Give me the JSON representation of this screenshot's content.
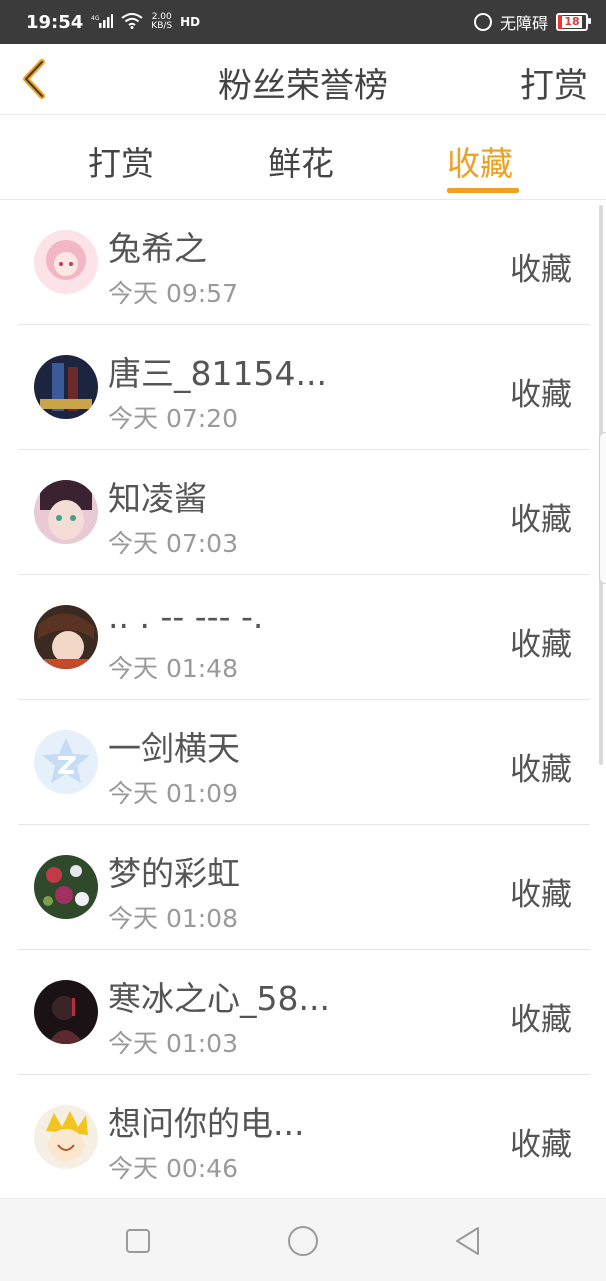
{
  "status_bar": {
    "time": "19:54",
    "network": "4G",
    "speed_value": "2.00",
    "speed_unit": "KB/S",
    "hd": "HD",
    "accessibility": "无障碍",
    "battery": "18"
  },
  "header": {
    "title": "粉丝荣誉榜",
    "action": "打赏"
  },
  "tabs": [
    {
      "label": "打赏",
      "active": false
    },
    {
      "label": "鲜花",
      "active": false
    },
    {
      "label": "收藏",
      "active": true
    }
  ],
  "accent_color": "#f0a020",
  "list": [
    {
      "name": "兔希之",
      "time": "今天 09:57",
      "action": "收藏"
    },
    {
      "name": "唐三_81154...",
      "time": "今天 07:20",
      "action": "收藏"
    },
    {
      "name": "知凌酱",
      "time": "今天 07:03",
      "action": "收藏"
    },
    {
      "name": ".. . -- --- -.",
      "time": "今天 01:48",
      "action": "收藏"
    },
    {
      "name": "一剑横天",
      "time": "今天 01:09",
      "action": "收藏"
    },
    {
      "name": "梦的彩虹",
      "time": "今天 01:08",
      "action": "收藏"
    },
    {
      "name": "寒冰之心_58...",
      "time": "今天 01:03",
      "action": "收藏"
    },
    {
      "name": "想问你的电...",
      "time": "今天 00:46",
      "action": "收藏"
    }
  ]
}
